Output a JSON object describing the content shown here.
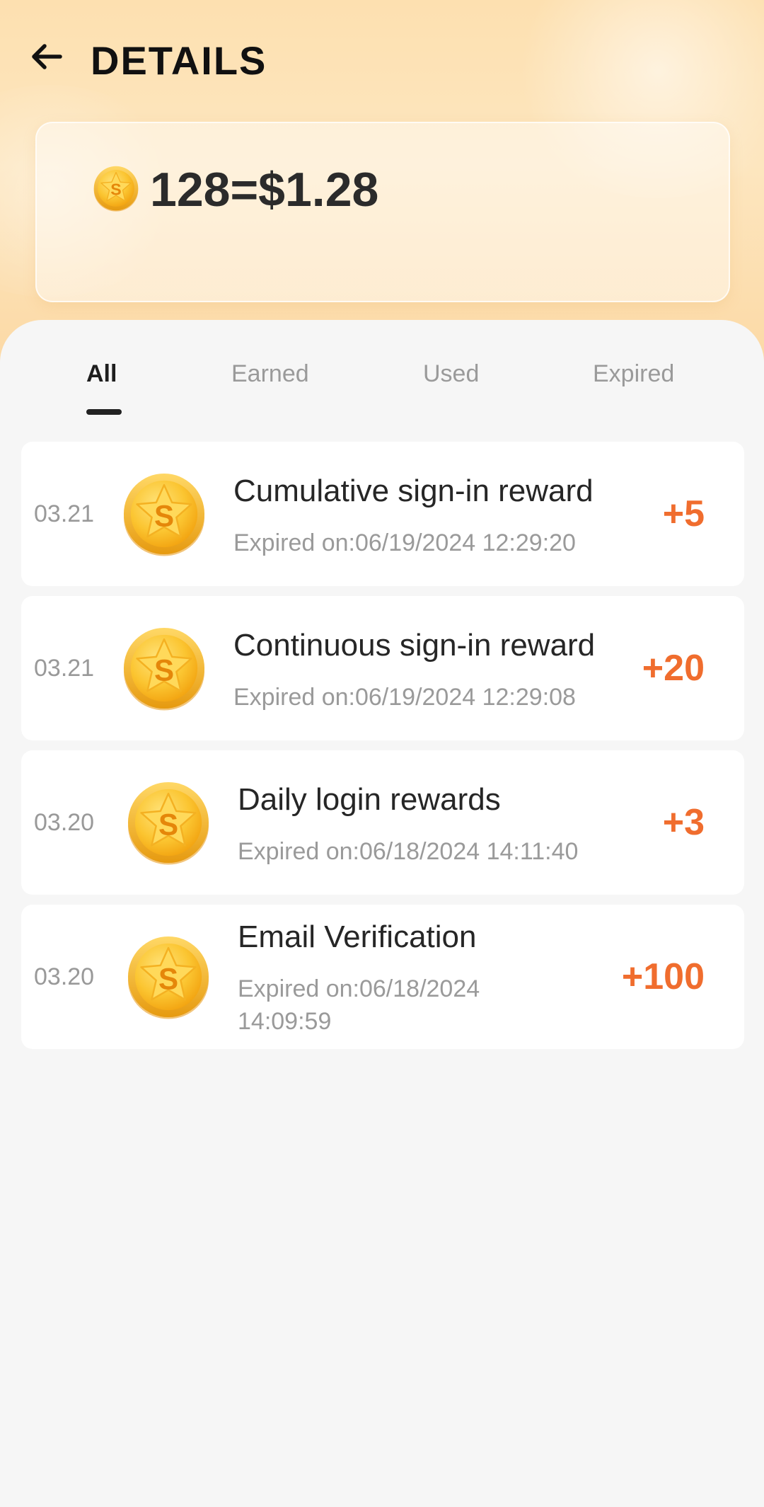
{
  "header": {
    "title": "DETAILS",
    "back_icon": "arrow-left-icon"
  },
  "balance": {
    "text": "128=$1.28",
    "icon": "coin-icon"
  },
  "tabs": [
    {
      "label": "All",
      "active": true
    },
    {
      "label": "Earned",
      "active": false
    },
    {
      "label": "Used",
      "active": false
    },
    {
      "label": "Expired",
      "active": false
    }
  ],
  "records": [
    {
      "date": "03.21",
      "title": "Cumulative sign-in reward",
      "subtitle": "Expired on:06/19/2024 12:29:20",
      "points": "+5"
    },
    {
      "date": "03.21",
      "title": "Continuous sign-in reward",
      "subtitle": "Expired on:06/19/2024 12:29:08",
      "points": "+20"
    },
    {
      "date": "03.20",
      "title": "Daily login rewards",
      "subtitle": "Expired on:06/18/2024 14:11:40",
      "points": "+3"
    },
    {
      "date": "03.20",
      "title": "Email Verification",
      "subtitle": "Expired on:06/18/2024 14:09:59",
      "points": "+100"
    }
  ],
  "colors": {
    "accent": "#f06d2e",
    "coin": "#f8b822",
    "header_bg": "#fde0b0"
  }
}
